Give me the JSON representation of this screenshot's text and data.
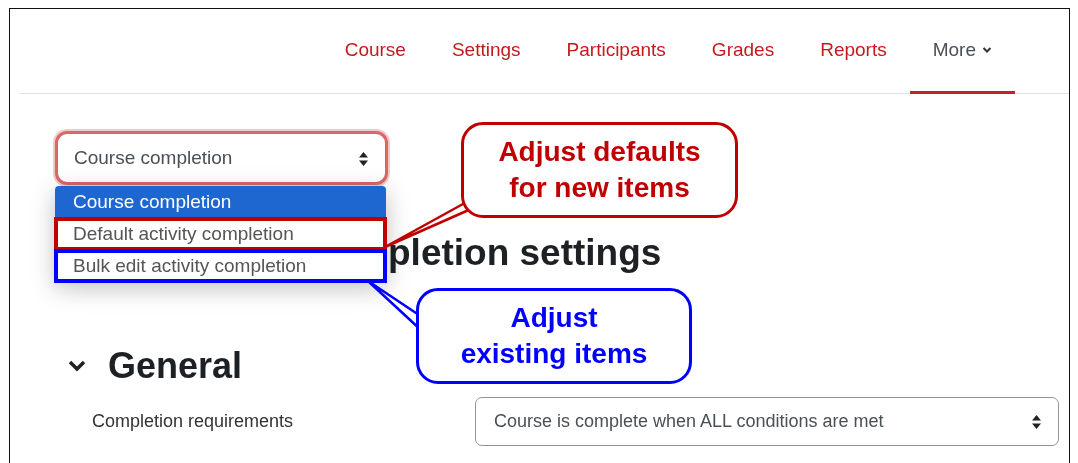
{
  "nav": {
    "tabs": [
      {
        "label": "Course",
        "selected": false,
        "kind": "link"
      },
      {
        "label": "Settings",
        "selected": false,
        "kind": "link"
      },
      {
        "label": "Participants",
        "selected": false,
        "kind": "link"
      },
      {
        "label": "Grades",
        "selected": false,
        "kind": "link"
      },
      {
        "label": "Reports",
        "selected": false,
        "kind": "link"
      },
      {
        "label": "More",
        "selected": true,
        "kind": "dropdown"
      }
    ]
  },
  "page_select": {
    "value": "Course completion",
    "expanded": true,
    "options": [
      {
        "label": "Course completion",
        "selected": true
      },
      {
        "label": "Default activity completion",
        "selected": false,
        "color": "#c00000"
      },
      {
        "label": "Bulk edit activity completion",
        "selected": false,
        "color": "#0000ff"
      }
    ]
  },
  "heading": "pletion settings",
  "callouts": [
    {
      "lines": [
        "Adjust defaults",
        "for new items"
      ],
      "color": "#c00000"
    },
    {
      "lines": [
        "Adjust",
        "existing items"
      ],
      "color": "#0000ff"
    }
  ],
  "section": {
    "title": "General",
    "expanded": true,
    "fields": [
      {
        "label": "Completion requirements",
        "value": "Course is complete when ALL conditions are met"
      }
    ]
  }
}
